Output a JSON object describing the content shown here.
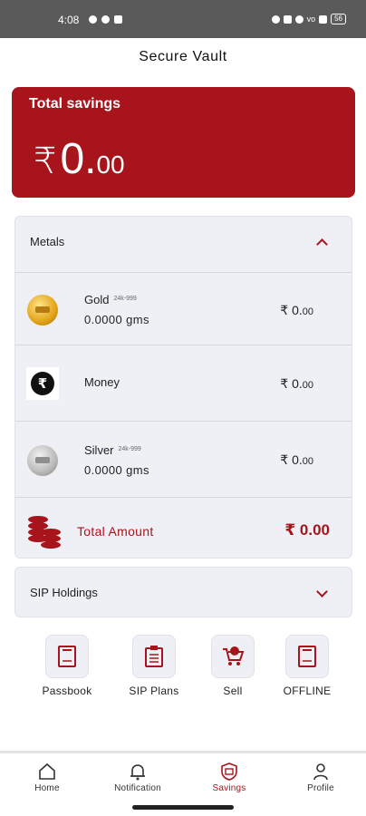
{
  "status_bar": {
    "time": "4:08",
    "battery": "56",
    "network": "vo"
  },
  "page": {
    "title": "Secure Vault"
  },
  "savings": {
    "label": "Total savings",
    "currency": "₹",
    "amount_int": "0.",
    "amount_dec": "00"
  },
  "metals": {
    "header": "Metals",
    "rows": [
      {
        "name": "Gold",
        "purity": "24k-999",
        "weight": "0.0000  gms",
        "value_int": "₹ 0.",
        "value_dec": "00",
        "icon": "gold-coin-icon"
      },
      {
        "name": "Money",
        "value_int": "₹ 0.",
        "value_dec": "00",
        "icon": "rupee-icon"
      },
      {
        "name": "Silver",
        "purity": "24k-999",
        "weight": "0.0000  gms",
        "value_int": "₹ 0.",
        "value_dec": "00",
        "icon": "silver-coin-icon"
      }
    ],
    "total_label": "Total Amount",
    "total_value": "₹ 0.00"
  },
  "sip": {
    "header": "SIP Holdings"
  },
  "actions": [
    {
      "label": "Passbook",
      "icon": "passbook-icon"
    },
    {
      "label": "SIP Plans",
      "icon": "clipboard-icon"
    },
    {
      "label": "Sell",
      "icon": "cart-icon"
    },
    {
      "label": "OFFLINE",
      "icon": "book-icon"
    }
  ],
  "nav": [
    {
      "label": "Home",
      "icon": "home-icon"
    },
    {
      "label": "Notification",
      "icon": "bell-icon"
    },
    {
      "label": "Savings",
      "icon": "savings-icon",
      "active": true
    },
    {
      "label": "Profile",
      "icon": "profile-icon"
    }
  ],
  "colors": {
    "accent": "#a8141c",
    "panel": "#eef0f5"
  }
}
